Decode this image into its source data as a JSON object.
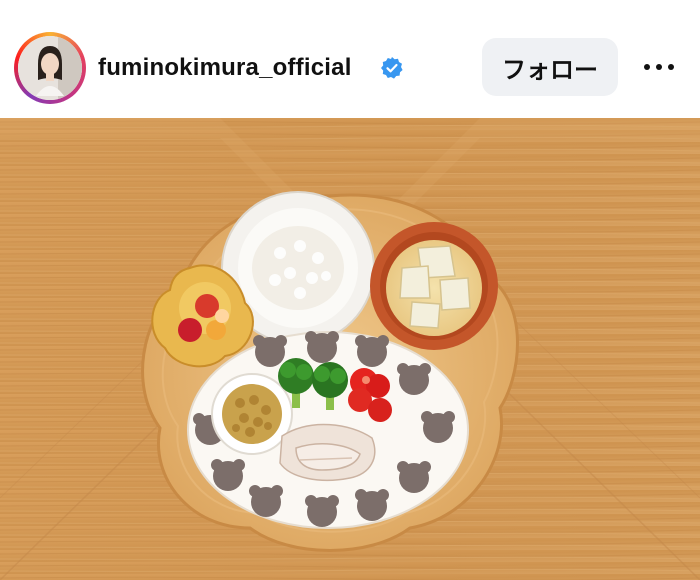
{
  "post": {
    "username": "fuminokimura_official",
    "verified": true,
    "follow_label": "フォロー",
    "avatar_icon": "profile-photo",
    "verified_icon": "verified-badge-icon",
    "more_icon": "more-options-icon"
  },
  "photo": {
    "icon": "meal-photo"
  },
  "colors": {
    "verified_blue": "#3897f0",
    "follow_bg": "#eff1f4",
    "wood_table": "#d9a05f"
  }
}
